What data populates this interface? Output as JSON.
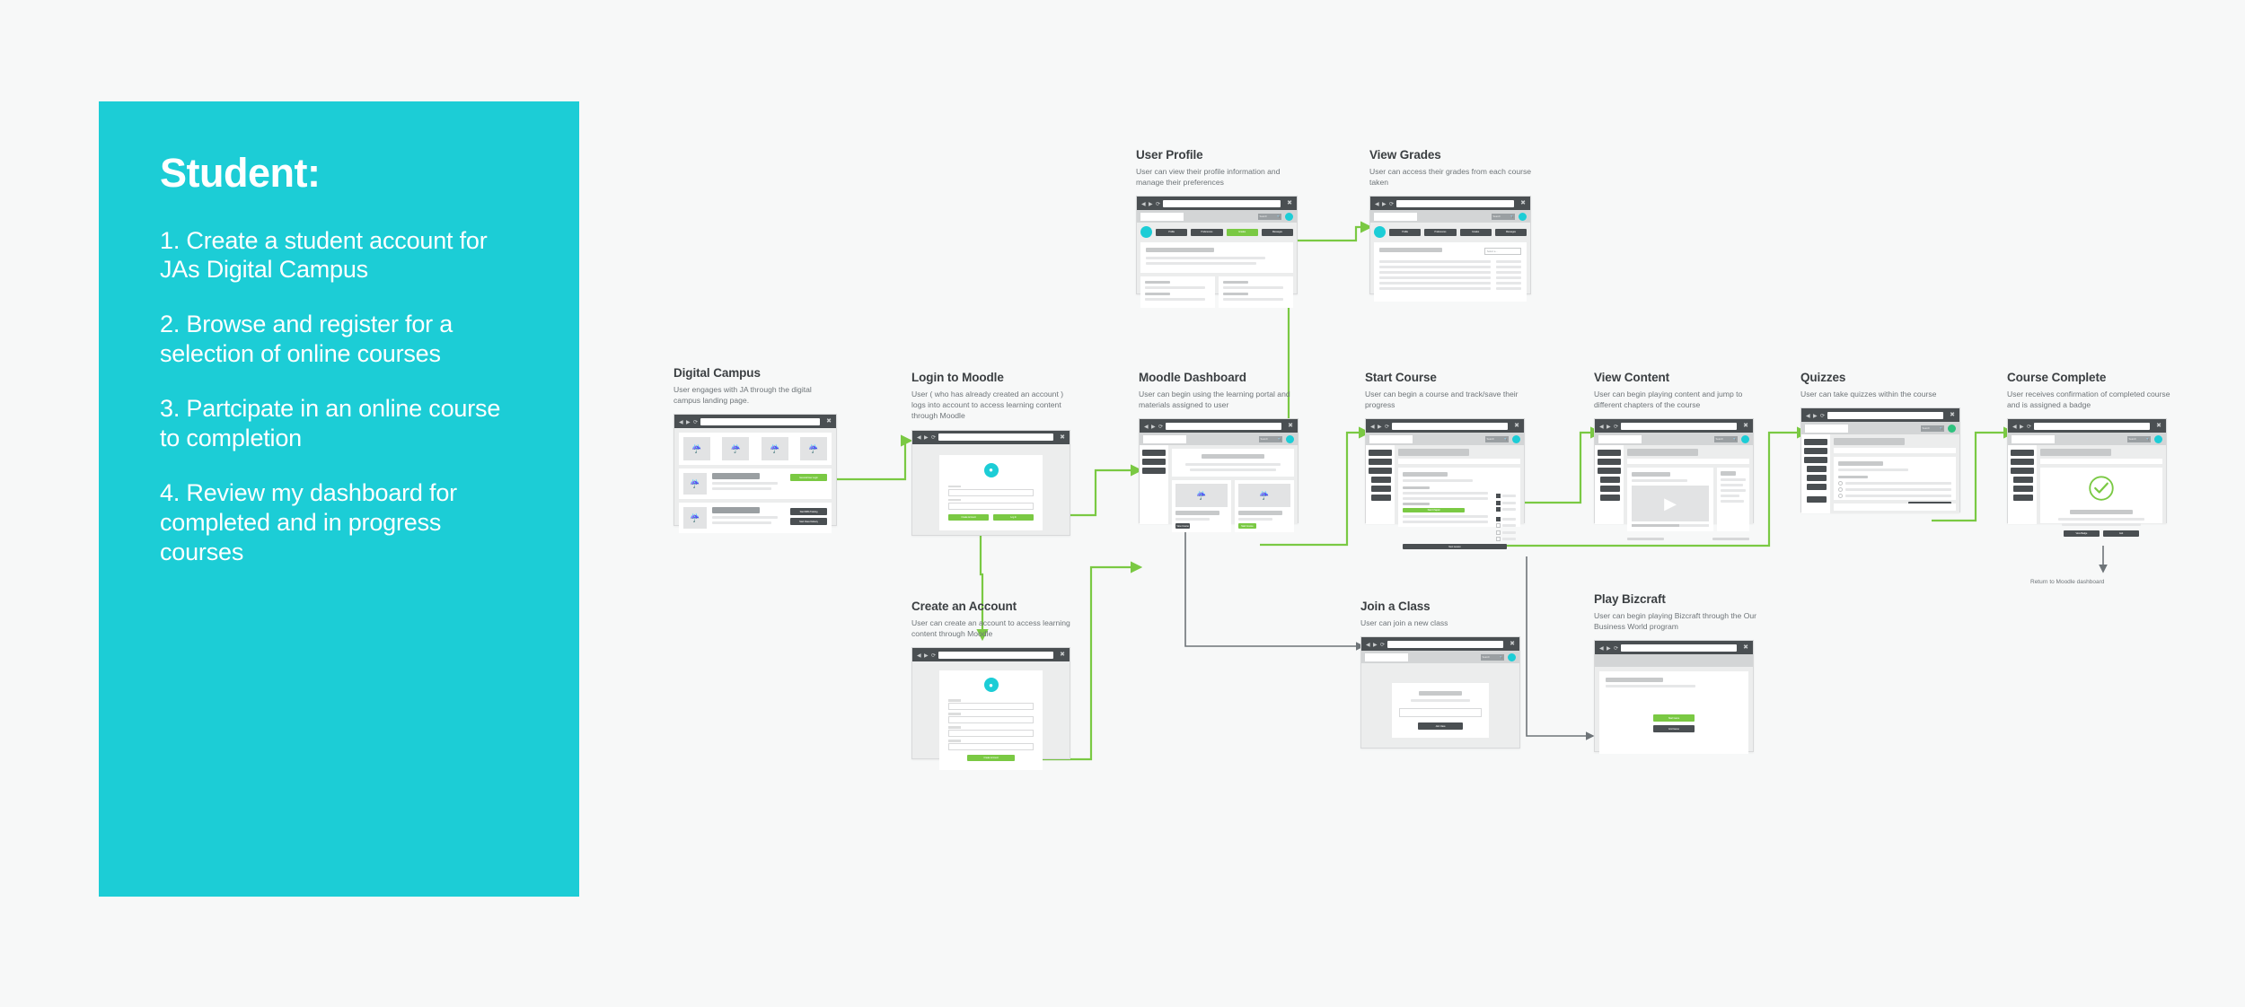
{
  "persona": {
    "title": "Student:",
    "steps": [
      "1. Create a student account for JAs Digital Campus",
      "2. Browse and register for a selection of online courses",
      "3. Partcipate in an online course to completion",
      "4. Review my dashboard for completed and in progress courses"
    ]
  },
  "colors": {
    "panel_teal": "#1ccdd6",
    "background": "#f7f8f8",
    "connector_green": "#7ac943",
    "connector_grey": "#6e7478",
    "chrome_dark": "#4a4f52",
    "accent_green_btn": "#7ac943"
  },
  "annotations": {
    "return_to_dashboard": "Return to Moodle dashboard"
  },
  "nodes": [
    {
      "id": "digital-campus",
      "title": "Digital Campus",
      "desc": "User engages with JA through the digital campus landing page.",
      "buttons": [
        "General User Login",
        "Start MBA Training",
        "Start Class Delivery"
      ]
    },
    {
      "id": "login-to-moodle",
      "title": "Login to Moodle",
      "desc": "User ( who has already created an account ) logs into account to access learning content through Moodle",
      "buttons": [
        "Create Account",
        "Log In"
      ]
    },
    {
      "id": "create-an-account",
      "title": "Create an Account",
      "desc": "User can create an account to access learning content through Moodle",
      "buttons": [
        "Create Account"
      ]
    },
    {
      "id": "moodle-dashboard",
      "title": "Moodle Dashboard",
      "desc": "User can begin using the learning portal and materials assigned to user",
      "nav": [
        "Dashboard",
        "Join Class",
        "My Courses"
      ],
      "buttons": [
        "View Course",
        "Start Course"
      ]
    },
    {
      "id": "user-profile",
      "title": "User Profile",
      "desc": "User can view their profile information and manage their preferences",
      "tabs": [
        "Profile",
        "Preferences",
        "Grades",
        "Messages"
      ]
    },
    {
      "id": "view-grades",
      "title": "View Grades",
      "desc": "User can access their grades from each course taken",
      "tabs": [
        "Profile",
        "Preferences",
        "Grades",
        "Messages"
      ],
      "select": "Select a..."
    },
    {
      "id": "start-course",
      "title": "Start Course",
      "desc": "User can begin a course and track/save their progress",
      "nav": [
        "Dashboard",
        "Join Class",
        "My Courses",
        "Grades",
        "Video Intro",
        "Extra Resources"
      ],
      "buttons": [
        "Start Chapter",
        "Next Lesson"
      ]
    },
    {
      "id": "view-content",
      "title": "View Content",
      "desc": "User can begin playing content and jump to different chapters of the course",
      "nav": [
        "Dashboard",
        "Join Class",
        "My Courses",
        "Grades",
        "Video Intro",
        "Extra Resources"
      ]
    },
    {
      "id": "quizzes",
      "title": "Quizzes",
      "desc": "User can take quizzes within the course",
      "nav": [
        "Dashboard",
        "Join Class",
        "My Courses",
        "Grades",
        "Video Intro",
        "Extra Resources",
        "Submit"
      ],
      "buttons": [
        "Submit Quiz"
      ]
    },
    {
      "id": "course-complete",
      "title": "Course Complete",
      "desc": "User receives confirmation of completed course and is assigned a badge",
      "nav": [
        "Dashboard",
        "Join Class",
        "My Courses",
        "Grades",
        "Video Intro",
        "Extra Resources"
      ],
      "buttons": [
        "View Badge",
        "Exit"
      ]
    },
    {
      "id": "join-a-class",
      "title": "Join a Class",
      "desc": "User can join a new class",
      "buttons": [
        "Join Class"
      ]
    },
    {
      "id": "play-bizcraft",
      "title": "Play Bizcraft",
      "desc": "User can begin playing Bizcraft through the Our Business World program",
      "buttons": [
        "Start Game",
        "End Game"
      ]
    }
  ]
}
